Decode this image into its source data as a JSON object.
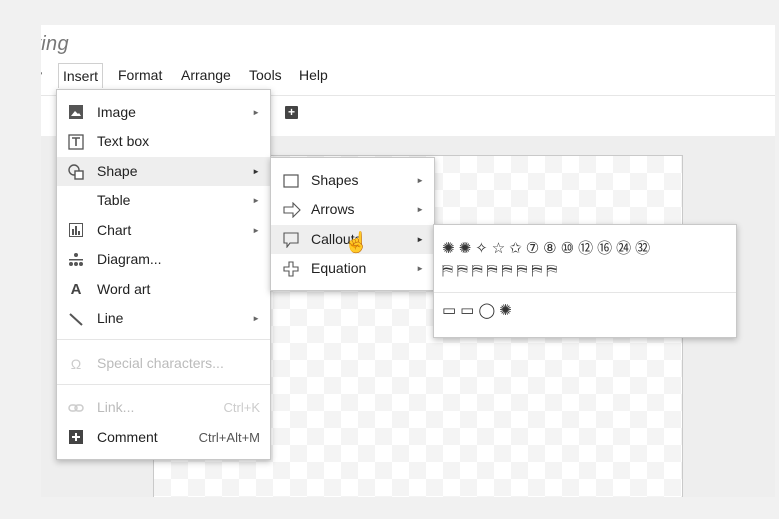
{
  "app": {
    "title": "ving"
  },
  "menubar": [
    {
      "label": "v"
    },
    {
      "label": "Insert"
    },
    {
      "label": "Format"
    },
    {
      "label": "Arrange"
    },
    {
      "label": "Tools"
    },
    {
      "label": "Help"
    }
  ],
  "insert_menu": {
    "items": [
      {
        "label": "Image",
        "icon": "image-icon"
      },
      {
        "label": "Text box",
        "icon": "text-box-icon"
      },
      {
        "label": "Shape",
        "icon": "shape-icon"
      },
      {
        "label": "Table"
      },
      {
        "label": "Chart",
        "icon": "chart-icon"
      },
      {
        "label": "Diagram...",
        "icon": "diagram-icon"
      },
      {
        "label": "Word art",
        "icon": "word-art-icon"
      },
      {
        "label": "Line",
        "icon": "line-icon"
      },
      {
        "label": "Special characters...",
        "icon": "omega-icon"
      },
      {
        "label": "Link...",
        "shortcut": "Ctrl+K",
        "icon": "link-icon"
      },
      {
        "label": "Comment",
        "shortcut": "Ctrl+Alt+M",
        "icon": "comment-icon"
      }
    ]
  },
  "shape_submenu": {
    "items": [
      {
        "label": "Shapes",
        "icon": "rectangle-icon"
      },
      {
        "label": "Arrows",
        "icon": "arrow-icon"
      },
      {
        "label": "Callouts",
        "icon": "callout-icon"
      },
      {
        "label": "Equation",
        "icon": "plus-icon"
      }
    ]
  },
  "callouts_panel": {
    "row1": "✺✺✧☆✩⑦⑧⑩⑫⑯㉔㉜",
    "row2": "⛿⛿⛿⛿⛿⛿⛿⛿",
    "row3": "▭▭◯✺"
  },
  "colors": {
    "highlight": "#eeeeee",
    "menu_border": "#c8c8c8"
  }
}
